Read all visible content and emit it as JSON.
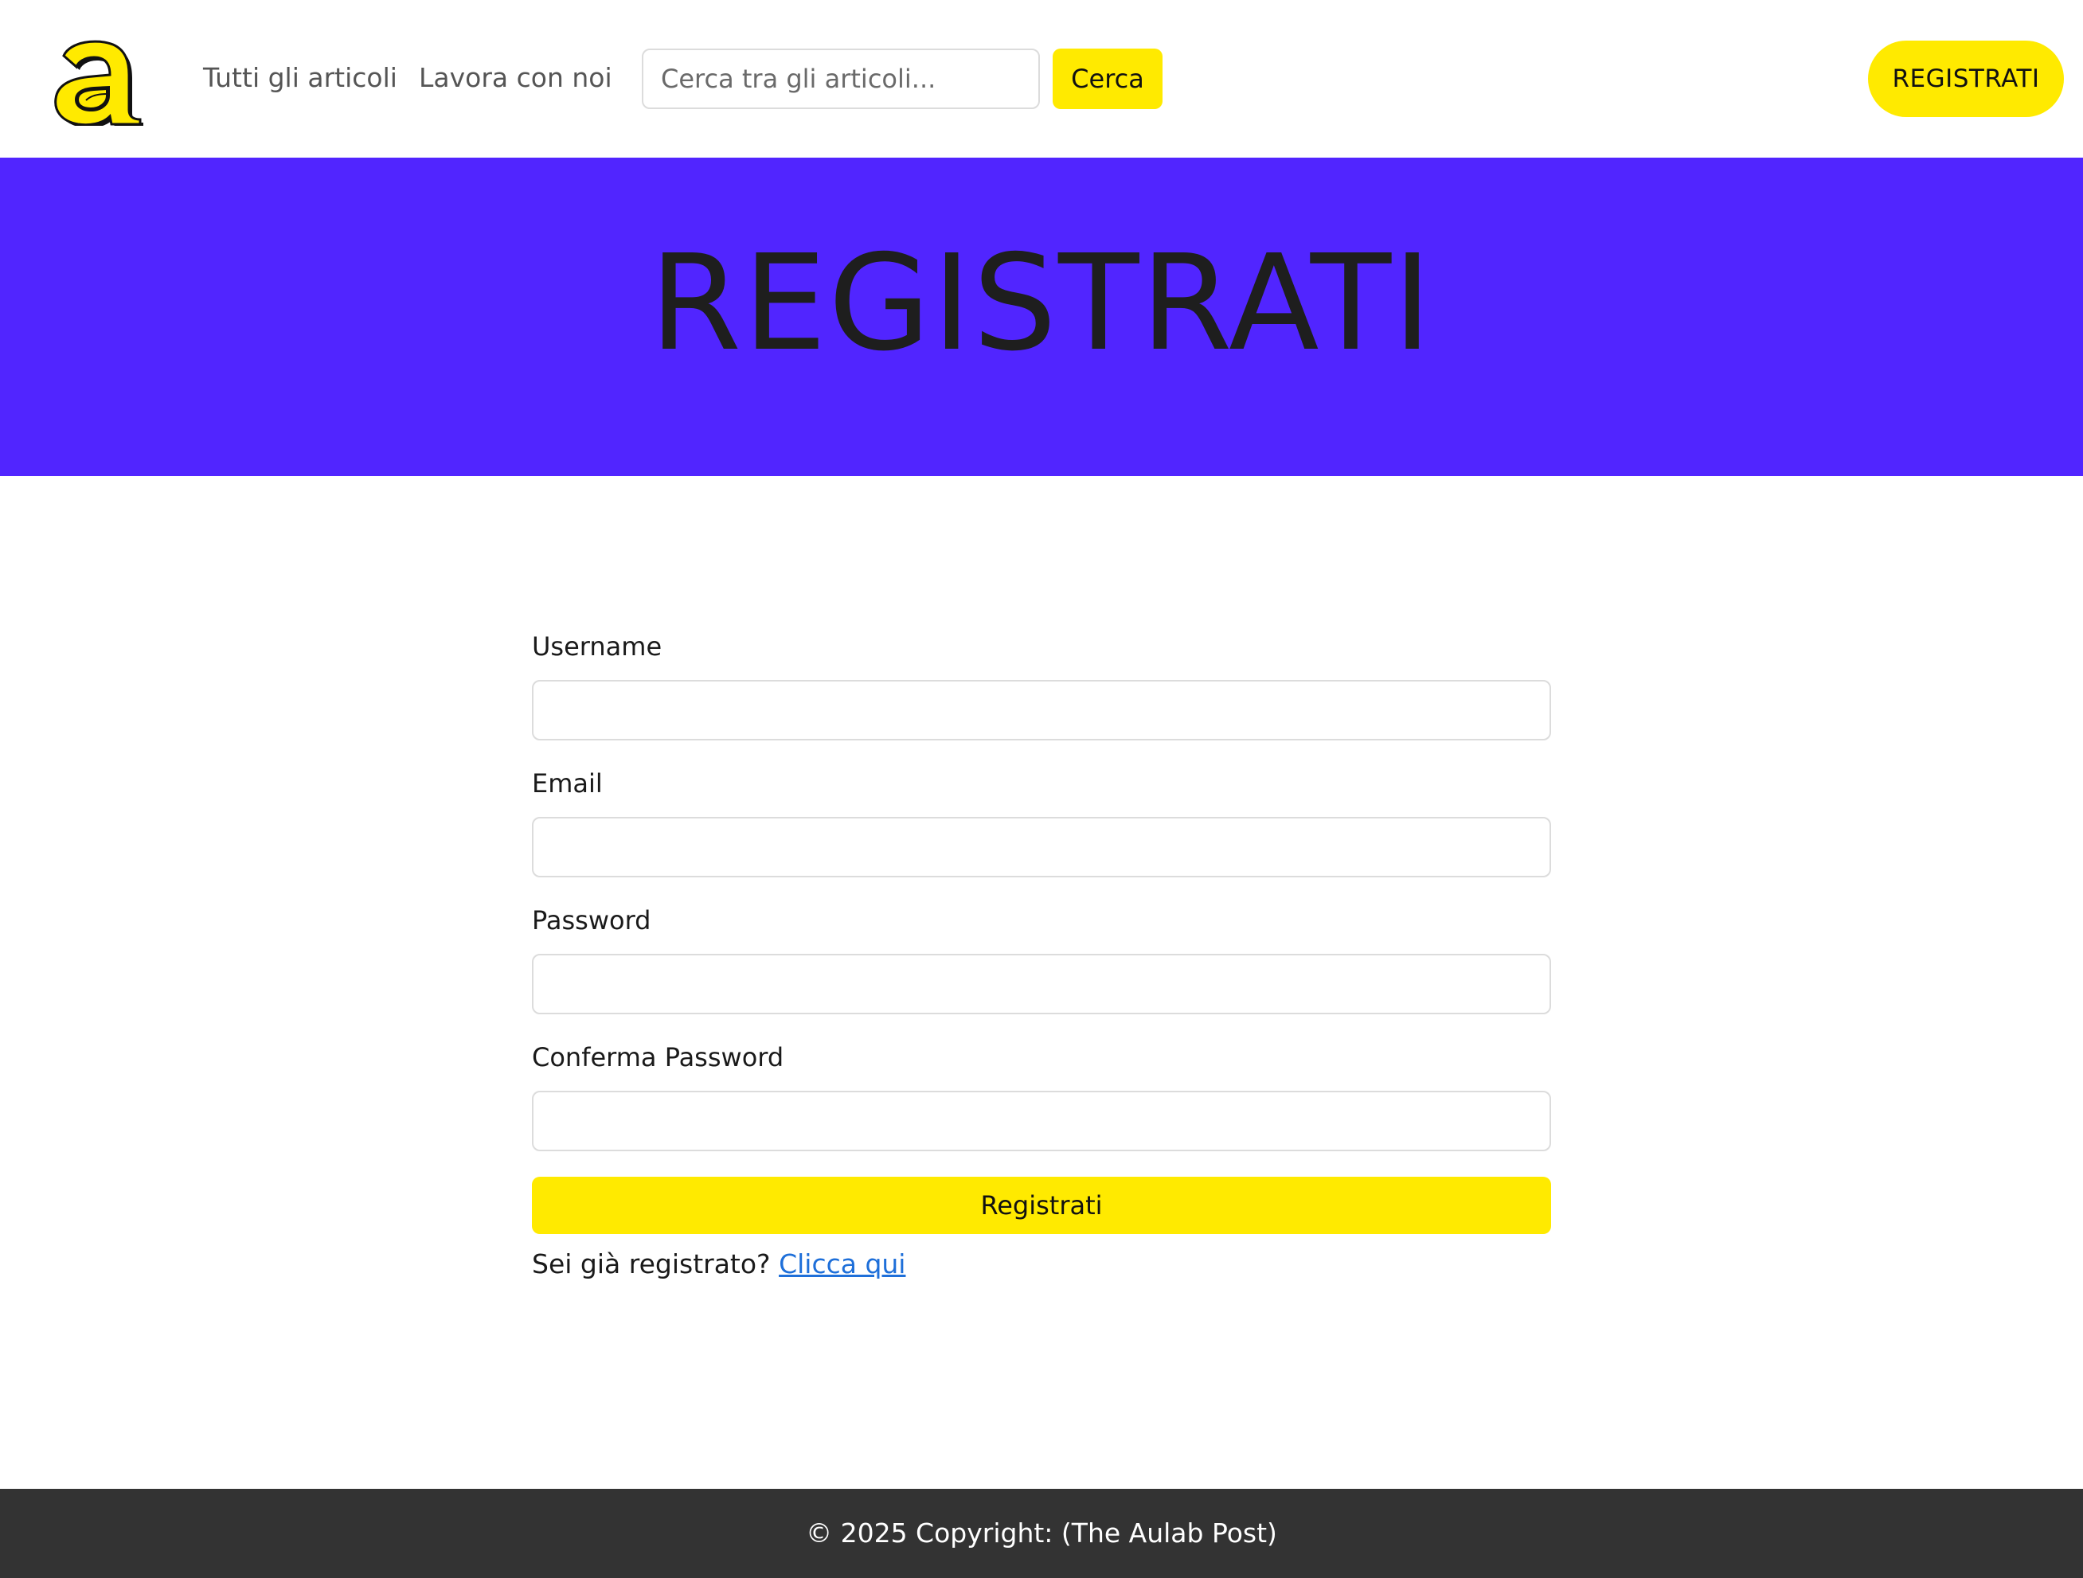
{
  "colors": {
    "accent_yellow": "#ffea00",
    "hero_purple": "#5125ff",
    "footer_dark": "#333333",
    "link_blue": "#1e6fd9"
  },
  "navbar": {
    "logo_icon": "aulab-a-logo-icon",
    "links": [
      {
        "label": "Tutti gli articoli"
      },
      {
        "label": "Lavora con noi"
      }
    ],
    "search": {
      "placeholder": "Cerca tra gli articoli...",
      "value": "",
      "button_label": "Cerca"
    },
    "register_label": "REGISTRATI"
  },
  "hero": {
    "title": "REGISTRATI"
  },
  "form": {
    "fields": [
      {
        "label": "Username",
        "value": ""
      },
      {
        "label": "Email",
        "value": ""
      },
      {
        "label": "Password",
        "value": ""
      },
      {
        "label": "Conferma Password",
        "value": ""
      }
    ],
    "submit_label": "Registrati",
    "login_prompt": "Sei già registrato?",
    "login_link": "Clicca qui"
  },
  "footer": {
    "text": "© 2025 Copyright: (The Aulab Post)"
  }
}
